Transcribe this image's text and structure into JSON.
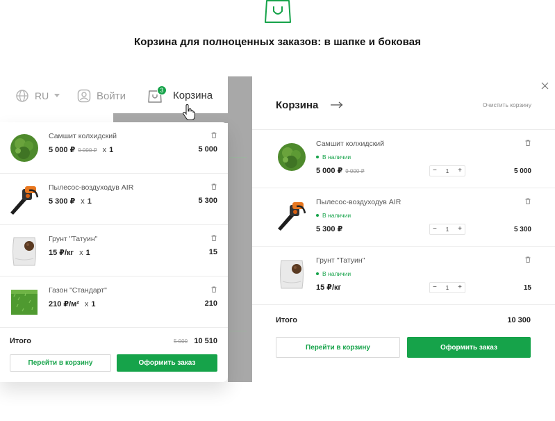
{
  "page": {
    "heading": "Корзина для полноценных заказов: в шапке и боковая"
  },
  "colors": {
    "accent": "#16a34a",
    "muted": "#9a9a9a",
    "backdrop": "#a8a8a8"
  },
  "header": {
    "lang": "RU",
    "login": "Войти",
    "cart_label": "Корзина",
    "cart_count": "3"
  },
  "dropdown": {
    "items": [
      {
        "name": "Самшит колхидский",
        "price": "5 000 ₽",
        "old_price": "9 000 ₽",
        "qty_text": "x",
        "qty": "1",
        "total": "5 000",
        "image": "boxwood-image"
      },
      {
        "name": "Пылесос-воздуходув AIR",
        "price": "5 300 ₽",
        "old_price": "",
        "qty_text": "x",
        "qty": "1",
        "total": "5 300",
        "image": "leaf-blower-image"
      },
      {
        "name": "Грунт \"Татуин\"",
        "price": "15 ₽/кг",
        "old_price": "",
        "qty_text": "x",
        "qty": "1",
        "total": "15",
        "image": "soil-bag-image"
      },
      {
        "name": "Газон \"Стандарт\"",
        "price": "210 ₽/м²",
        "old_price": "",
        "qty_text": "x",
        "qty": "1",
        "total": "210",
        "image": "lawn-image"
      }
    ],
    "total_label": "Итого",
    "total_old": "5 000",
    "total": "10 510",
    "go_to_cart": "Перейти в корзину",
    "checkout": "Оформить заказ"
  },
  "side_panel": {
    "title": "Корзина",
    "clear": "Очистить корзину",
    "items": [
      {
        "name": "Самшит колхидский",
        "stock": "В наличии",
        "price": "5 000 ₽",
        "old_price": "9 000 ₽",
        "qty": "1",
        "total": "5 000"
      },
      {
        "name": "Пылесос-воздуходув AIR",
        "stock": "В наличии",
        "price": "5 300 ₽",
        "old_price": "",
        "qty": "1",
        "total": "5 300"
      },
      {
        "name": "Грунт \"Татуин\"",
        "stock": "В наличии",
        "price": "15 ₽/кг",
        "old_price": "",
        "qty": "1",
        "total": "15"
      }
    ],
    "total_label": "Итого",
    "total": "10 300",
    "go_to_cart": "Перейти в корзину",
    "checkout": "Оформить заказ"
  }
}
